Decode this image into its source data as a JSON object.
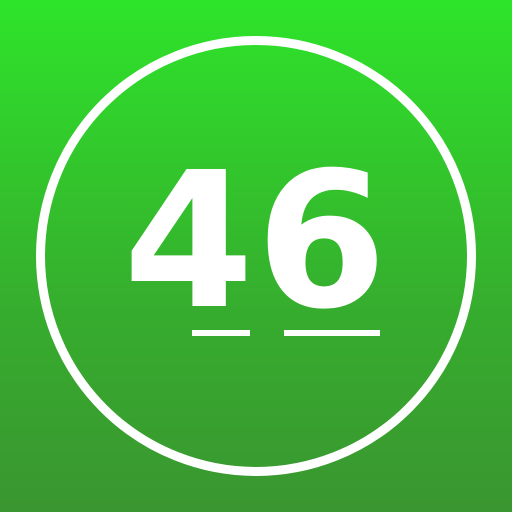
{
  "icon": {
    "number": "46",
    "colors": {
      "background_top": "#2ee42a",
      "background_bottom": "#3a9630",
      "foreground": "#ffffff"
    }
  }
}
